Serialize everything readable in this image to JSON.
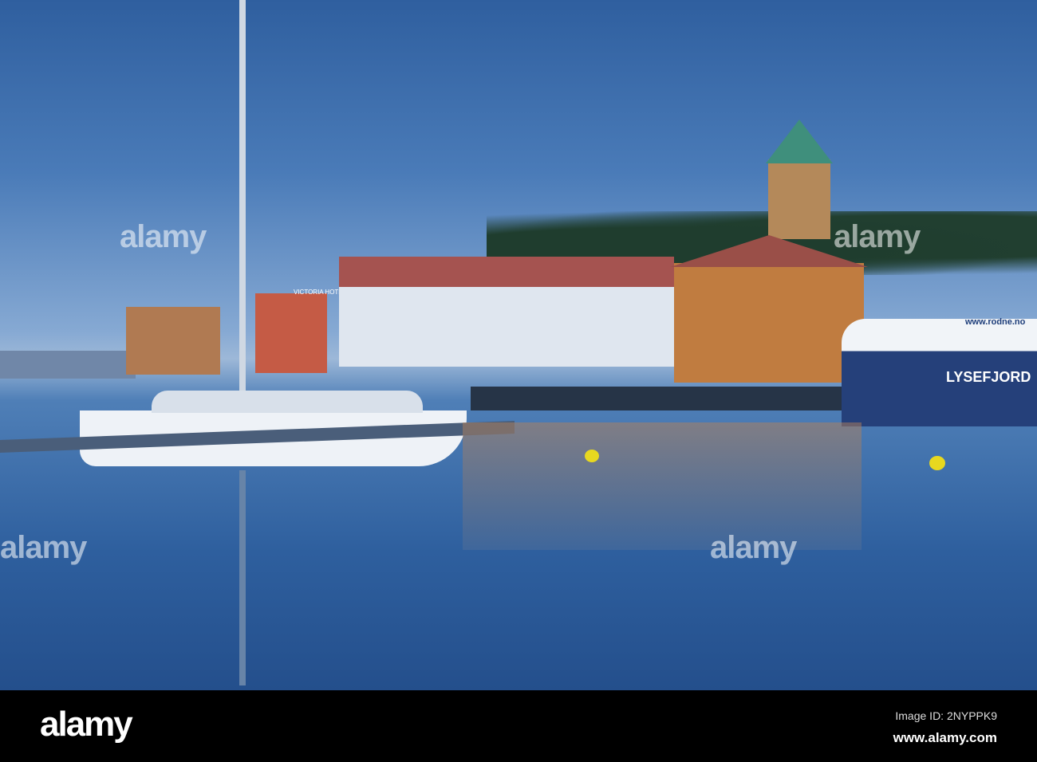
{
  "watermark": {
    "text": "alamy"
  },
  "signs": {
    "hotel": "VICTORIA HOTEL",
    "ferry_name": "LYSEFJORD",
    "ferry_url": "www.rodne.no"
  },
  "footer": {
    "logo": "alamy",
    "image_id": "Image ID: 2NYPPK9",
    "url": "www.alamy.com"
  }
}
